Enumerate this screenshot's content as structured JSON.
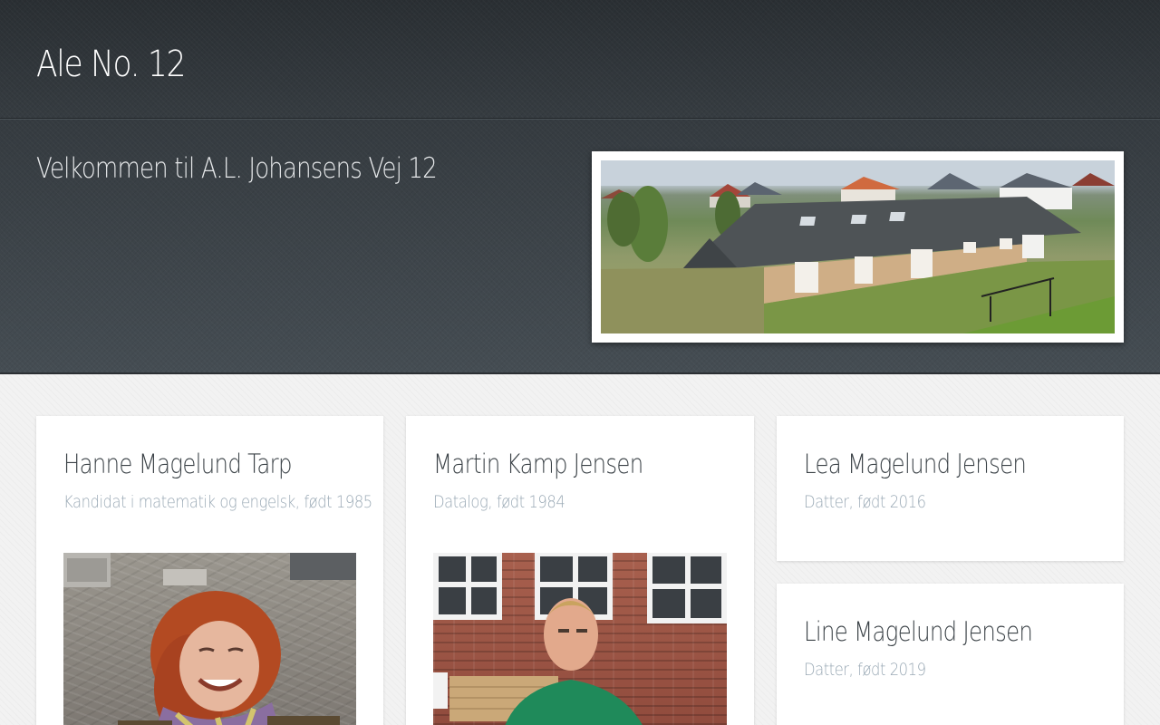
{
  "header": {
    "site_title": "Ale No. 12"
  },
  "hero": {
    "heading": "Velkommen til A.L. Johansens Vej 12",
    "photo_alt": "house-aerial-photo"
  },
  "people": [
    {
      "name": "Hanne Magelund Tarp",
      "description": "Kandidat i matematik og engelsk, født 1985",
      "photo": "portrait-photo-hanne"
    },
    {
      "name": "Martin Kamp Jensen",
      "description": "Datalog, født 1984",
      "photo": "portrait-photo-martin"
    },
    {
      "name": "Lea Magelund Jensen",
      "description": "Datter, født 2016"
    },
    {
      "name": "Line Magelund Jensen",
      "description": "Datter, født 2019"
    }
  ],
  "colors": {
    "header_bg": "#2f3438",
    "hero_bg": "#3d4449",
    "title_text": "#ffffff",
    "card_name_text": "#3b4247",
    "card_desc_text": "#9aa9b5",
    "content_bg": "#f2f2f2"
  }
}
